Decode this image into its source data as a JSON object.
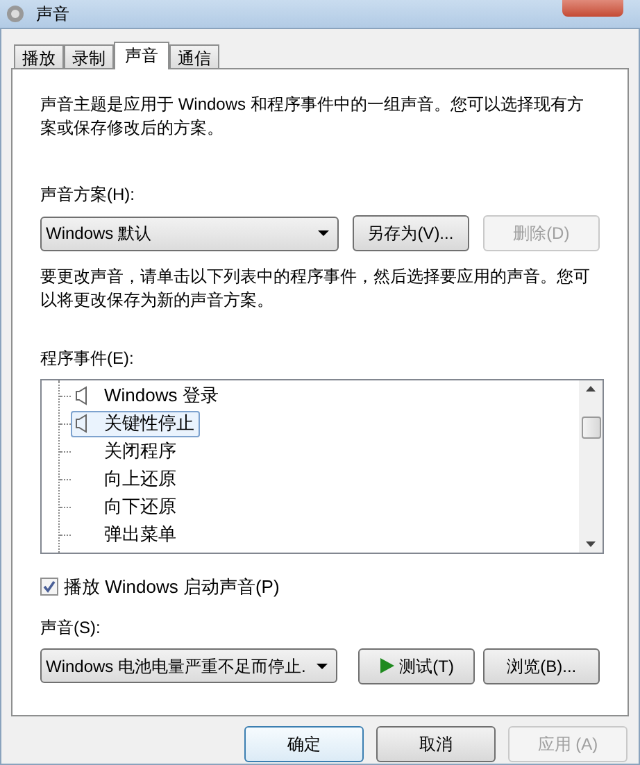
{
  "window": {
    "title": "声音"
  },
  "tabs": [
    {
      "label": "播放",
      "selected": false
    },
    {
      "label": "录制",
      "selected": false
    },
    {
      "label": "声音",
      "selected": true
    },
    {
      "label": "通信",
      "selected": false
    }
  ],
  "description": "声音主题是应用于 Windows 和程序事件中的一组声音。您可以选择现有方案或保存修改后的方案。",
  "scheme": {
    "label": "声音方案(H):",
    "value": "Windows 默认",
    "save_button": {
      "label": "另存为(V)...",
      "disabled": false
    },
    "delete_button": {
      "label": "删除(D)",
      "disabled": true
    }
  },
  "instructions": "要更改声音，请单击以下列表中的程序事件，然后选择要应用的声音。您可以将更改保存为新的声音方案。",
  "events": {
    "label": "程序事件(E):",
    "items": [
      {
        "label": "Windows 登录",
        "has_sound": true,
        "selected": false
      },
      {
        "label": "关键性停止",
        "has_sound": true,
        "selected": true
      },
      {
        "label": "关闭程序",
        "has_sound": false,
        "selected": false
      },
      {
        "label": "向上还原",
        "has_sound": false,
        "selected": false
      },
      {
        "label": "向下还原",
        "has_sound": false,
        "selected": false
      },
      {
        "label": "弹出菜单",
        "has_sound": false,
        "selected": false
      }
    ]
  },
  "startup_checkbox": {
    "label": "播放 Windows 启动声音(P)",
    "checked": true
  },
  "sound": {
    "label": "声音(S):",
    "value": "Windows 电池电量严重不足而停止.",
    "test_button": {
      "label": "测试(T)",
      "disabled": false
    },
    "browse_button": {
      "label": "浏览(B)...",
      "disabled": false
    }
  },
  "footer_buttons": [
    {
      "label": "确定",
      "disabled": false,
      "default": true
    },
    {
      "label": "取消",
      "disabled": false,
      "default": false
    },
    {
      "label": "应用 (A)",
      "disabled": true,
      "default": false
    }
  ]
}
